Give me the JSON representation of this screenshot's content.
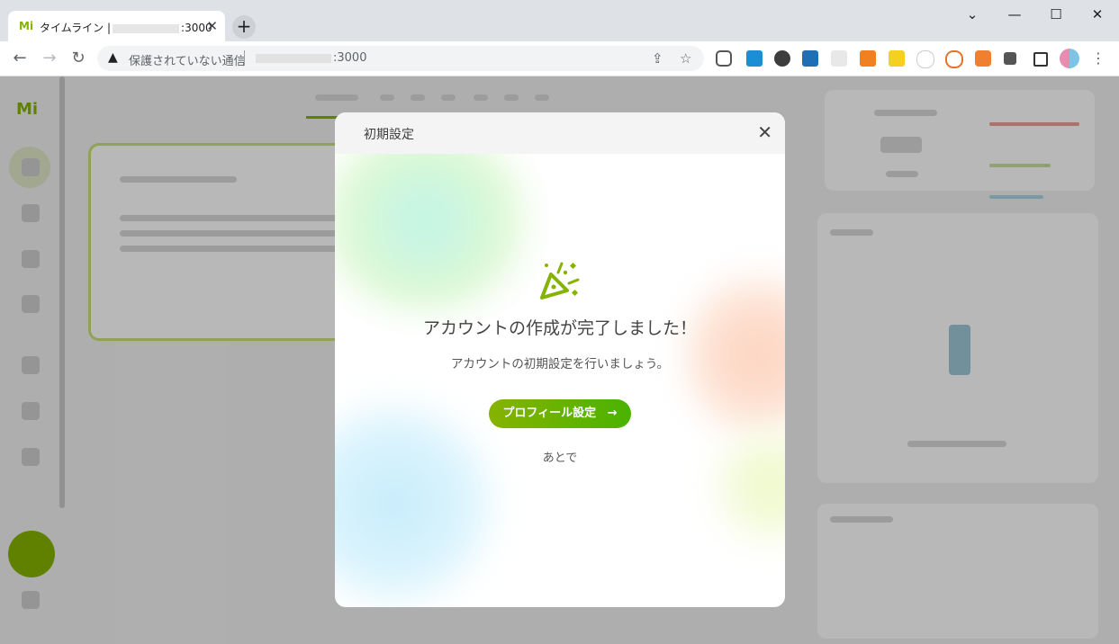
{
  "browser": {
    "tab": {
      "title": "タイムライン |",
      "title_suffix": ":3000",
      "favicon": "Mi"
    },
    "new_tab_symbol": "+",
    "window_controls": {
      "dropdown": "⌄",
      "minimize": "—",
      "maximize": "☐",
      "close": "✕"
    },
    "nav": {
      "back": "←",
      "forward": "→",
      "reload": "↻"
    },
    "address": {
      "security_status": "保護されていない通信",
      "url_suffix": ":3000"
    }
  },
  "dialog": {
    "title": "初期設定",
    "close_symbol": "✕",
    "heading": "アカウントの作成が完了しました！",
    "subtitle": "アカウントの初期設定を行いましょう。",
    "primary_button": "プロフィール設定",
    "primary_button_arrow": "→",
    "secondary_link": "あとで"
  },
  "colors": {
    "accent": "#86b300",
    "accent_end": "#4ab300"
  }
}
